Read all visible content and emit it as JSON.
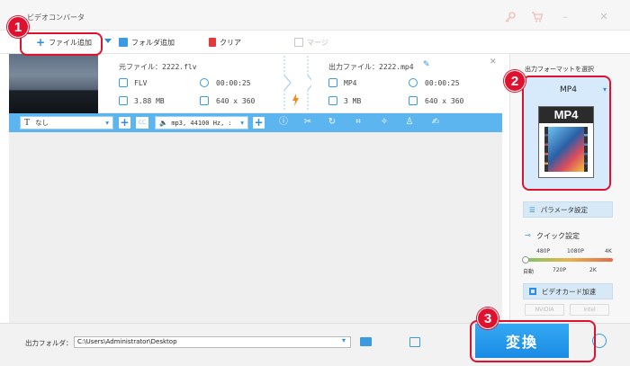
{
  "window": {
    "title": "ビデオコンバータ"
  },
  "toolbar": {
    "add_file": "ファイル追加",
    "add_folder": "フォルダ追加",
    "clear": "クリア",
    "merge": "マージ"
  },
  "source": {
    "label": "元ファイル：2222.flv",
    "format": "FLV",
    "duration": "00:00:25",
    "size": "3.88 MB",
    "resolution": "640 x 360"
  },
  "output": {
    "label": "出力ファイル：2222.mp4",
    "format": "MP4",
    "duration": "00:00:25",
    "size": "3 MB",
    "resolution": "640 x 360"
  },
  "editbar": {
    "subtitle_value": "なし",
    "cc_label": "CC",
    "audio_value": "mp3, 44100 Hz, :"
  },
  "right_panel": {
    "heading": "出力フォーマットを選択",
    "format_name": "MP4",
    "format_image_text": "MP4",
    "param_button": "パラメータ設定",
    "quick_label": "クイック設定",
    "quality_top": [
      "480P",
      "1080P",
      "4K"
    ],
    "quality_bottom": [
      "自動",
      "720P",
      "2K"
    ],
    "gpu_button": "ビデオカード加速",
    "gpu_nvidia": "NVIDIA",
    "gpu_intel": "Intel"
  },
  "bottom": {
    "output_label": "出力フォルダ：",
    "output_path": "C:\\Users\\Administrator\\Desktop",
    "convert_label": "変換"
  },
  "callouts": {
    "one": "1",
    "two": "2",
    "three": "3"
  },
  "colors": {
    "accent": "#5db5ef",
    "callout": "#e0112f",
    "convert": "#1a8be4"
  }
}
